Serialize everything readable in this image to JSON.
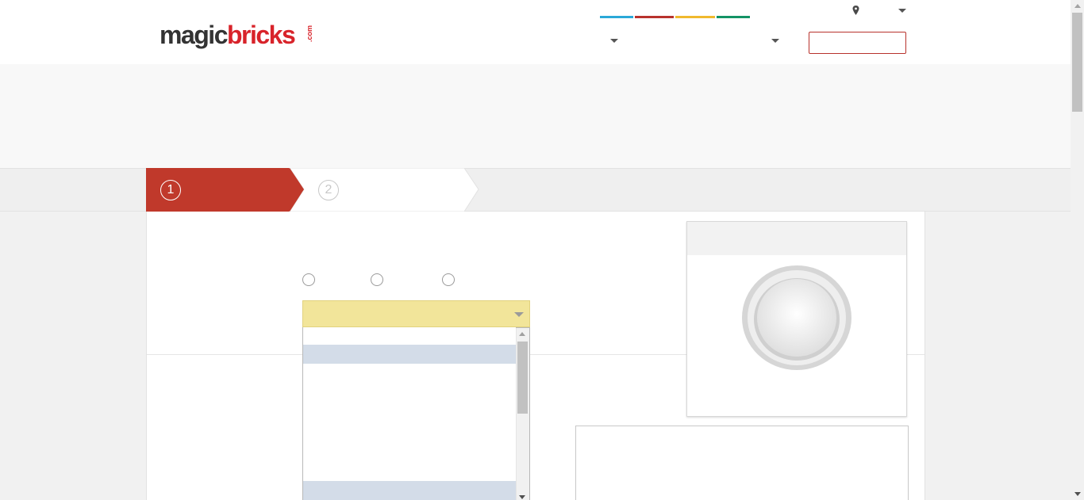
{
  "header": {
    "logo": {
      "part1": "magic",
      "part2": "bricks",
      "suffix": ".com"
    },
    "nav_accent_colors": [
      "#2aa8d8",
      "#b8322c",
      "#f0b92d",
      "#139365"
    ],
    "icons": [
      "location-pin-icon",
      "chevron-down-icon"
    ]
  },
  "steps": [
    {
      "number": "1",
      "state": "active",
      "color": "#c0392b"
    },
    {
      "number": "2",
      "state": "inactive"
    }
  ],
  "form": {
    "select_color": "#f2e59a",
    "highlight_color": "#d3dce8"
  }
}
